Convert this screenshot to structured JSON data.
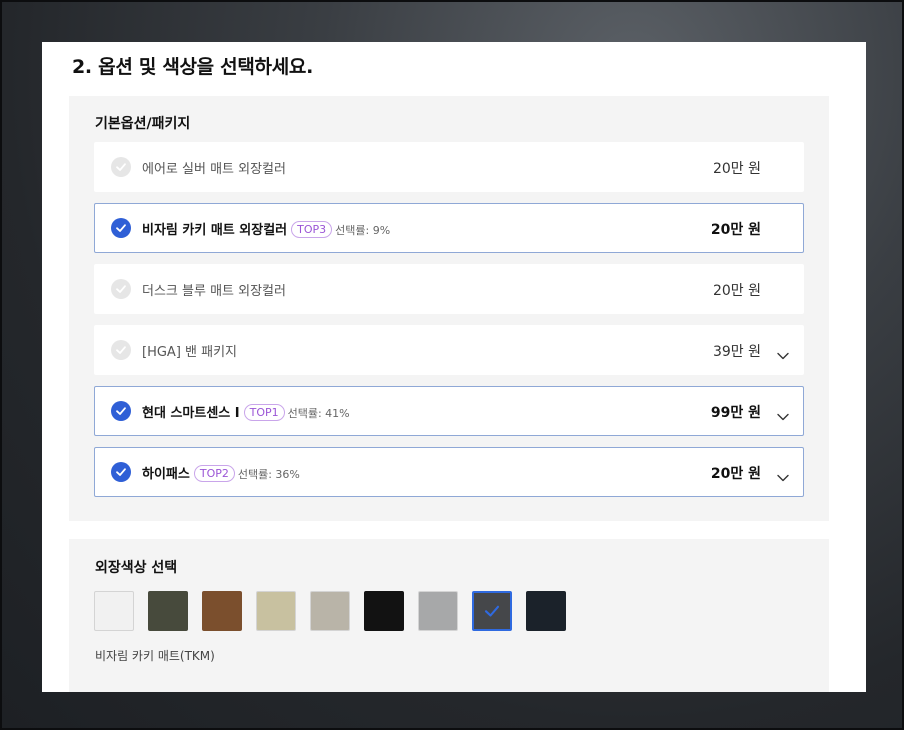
{
  "section_title": "2. 옵션 및 색상을 선택하세요.",
  "options_box": {
    "title": "기본옵션/패키지",
    "items": [
      {
        "name": "에어로 실버 매트 외장컬러",
        "price": "20만 원",
        "selected": false,
        "badge": "",
        "rate": "",
        "expandable": false
      },
      {
        "name": "비자림 카키 매트 외장컬러",
        "price": "20만 원",
        "selected": true,
        "badge": "TOP3",
        "rate": "선택률: 9%",
        "expandable": false
      },
      {
        "name": "더스크 블루 매트 외장컬러",
        "price": "20만 원",
        "selected": false,
        "badge": "",
        "rate": "",
        "expandable": false
      },
      {
        "name": "[HGA] 밴 패키지",
        "price": "39만 원",
        "selected": false,
        "badge": "",
        "rate": "",
        "expandable": true
      },
      {
        "name": "현대 스마트센스 I",
        "price": "99만 원",
        "selected": true,
        "badge": "TOP1",
        "rate": "선택률: 41%",
        "expandable": true
      },
      {
        "name": "하이패스",
        "price": "20만 원",
        "selected": true,
        "badge": "TOP2",
        "rate": "선택률: 36%",
        "expandable": true
      }
    ]
  },
  "colors_box": {
    "title": "외장색상 선택",
    "swatches": [
      {
        "color": "#f1f1f1",
        "selected": false
      },
      {
        "color": "#474a3c",
        "selected": false
      },
      {
        "color": "#7b4f2d",
        "selected": false
      },
      {
        "color": "#c8c1a0",
        "selected": false
      },
      {
        "color": "#b9b4a8",
        "selected": false
      },
      {
        "color": "#121212",
        "selected": false
      },
      {
        "color": "#a7a8a9",
        "selected": false
      },
      {
        "color": "#45474a",
        "selected": true
      },
      {
        "color": "#1b222a",
        "selected": false
      }
    ],
    "selected_color_name": "비자림 카키 매트(TKM)"
  },
  "colors": {
    "accent": "#2f5fd6",
    "badge": "#9b55d6",
    "selected_border": "#8fa8d6"
  },
  "icons": {
    "check": "check-icon",
    "expand": "chevron-down-icon"
  }
}
